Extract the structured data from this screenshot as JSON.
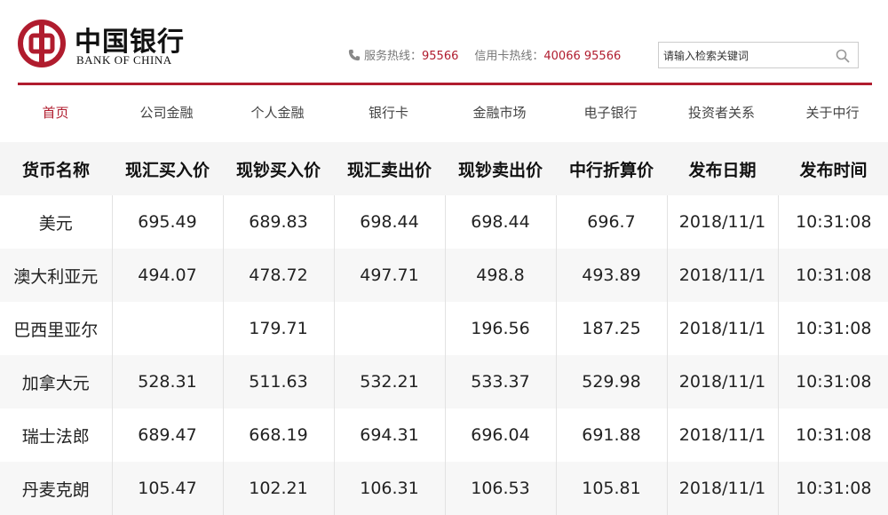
{
  "brand": {
    "name_cn": "中国银行",
    "name_en": "BANK OF CHINA",
    "color": "#b01c2e"
  },
  "hotlines": {
    "service_label": "服务热线：",
    "service_number": "95566",
    "card_label": "信用卡热线：",
    "card_number": "40066 95566"
  },
  "search": {
    "placeholder": "请输入检索关键词",
    "icon": "search-icon"
  },
  "nav": {
    "items": [
      {
        "label": "首页",
        "active": true
      },
      {
        "label": "公司金融"
      },
      {
        "label": "个人金融"
      },
      {
        "label": "银行卡"
      },
      {
        "label": "金融市场"
      },
      {
        "label": "电子银行"
      },
      {
        "label": "投资者关系"
      },
      {
        "label": "关于中行"
      }
    ]
  },
  "table": {
    "headers": [
      "货币名称",
      "现汇买入价",
      "现钞买入价",
      "现汇卖出价",
      "现钞卖出价",
      "中行折算价",
      "发布日期",
      "发布时间"
    ],
    "rows": [
      [
        "美元",
        "695.49",
        "689.83",
        "698.44",
        "698.44",
        "696.7",
        "2018/11/1",
        "10:31:08"
      ],
      [
        "澳大利亚元",
        "494.07",
        "478.72",
        "497.71",
        "498.8",
        "493.89",
        "2018/11/1",
        "10:31:08"
      ],
      [
        "巴西里亚尔",
        "",
        "179.71",
        "",
        "196.56",
        "187.25",
        "2018/11/1",
        "10:31:08"
      ],
      [
        "加拿大元",
        "528.31",
        "511.63",
        "532.21",
        "533.37",
        "529.98",
        "2018/11/1",
        "10:31:08"
      ],
      [
        "瑞士法郎",
        "689.47",
        "668.19",
        "694.31",
        "696.04",
        "691.88",
        "2018/11/1",
        "10:31:08"
      ],
      [
        "丹麦克朗",
        "105.47",
        "102.21",
        "106.31",
        "106.53",
        "105.81",
        "2018/11/1",
        "10:31:08"
      ]
    ]
  }
}
